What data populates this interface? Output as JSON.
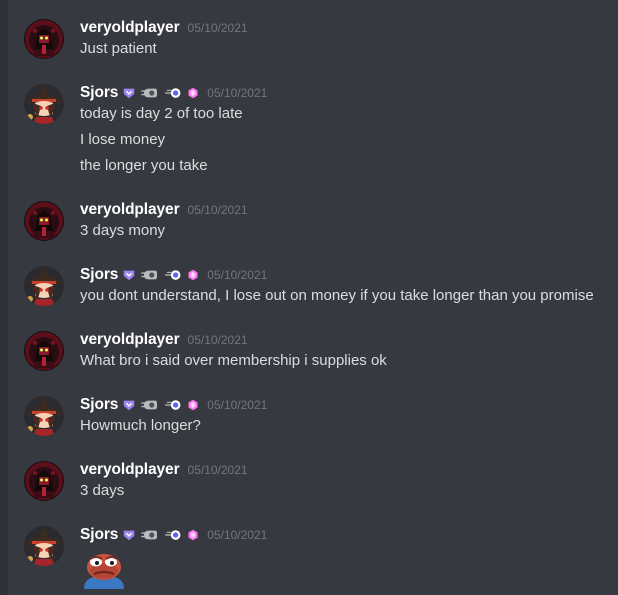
{
  "users": {
    "veryoldplayer": {
      "name": "veryoldplayer",
      "avatar_icon": "dark-character-avatar",
      "accent": "#7a1320"
    },
    "sjors": {
      "name": "Sjors",
      "avatar_icon": "witch-hat-girl-avatar",
      "accent": "#c8402e"
    }
  },
  "badges": {
    "hypesquad": "hypesquad-badge-icon",
    "nitro": "nitro-badge-icon",
    "boost_orb": "server-boost-orb-icon",
    "boost_gem": "boost-gem-icon"
  },
  "messages": [
    {
      "user": "veryoldplayer",
      "timestamp": "05/10/2021",
      "lines": [
        "Just patient"
      ]
    },
    {
      "user": "Sjors",
      "timestamp": "05/10/2021",
      "lines": [
        "today is day 2 of too late",
        "I lose money",
        "the longer you take"
      ]
    },
    {
      "user": "veryoldplayer",
      "timestamp": "05/10/2021",
      "lines": [
        "3 days mony"
      ]
    },
    {
      "user": "Sjors",
      "timestamp": "05/10/2021",
      "lines": [
        "you dont understand, I lose out on money if you take longer than you promise"
      ]
    },
    {
      "user": "veryoldplayer",
      "timestamp": "05/10/2021",
      "lines": [
        "What bro i said over membership i supplies ok"
      ]
    },
    {
      "user": "Sjors",
      "timestamp": "05/10/2021",
      "lines": [
        "Howmuch longer?"
      ]
    },
    {
      "user": "veryoldplayer",
      "timestamp": "05/10/2021",
      "lines": [
        "3 days"
      ]
    },
    {
      "user": "Sjors",
      "timestamp": "05/10/2021",
      "emoji": "sad-pepe-emoji"
    }
  ],
  "colors": {
    "background": "#36393f",
    "username": "#ffffff",
    "message_text": "#dcddde",
    "timestamp": "#72767d",
    "hypesquad_purple": "#9b84ee"
  }
}
